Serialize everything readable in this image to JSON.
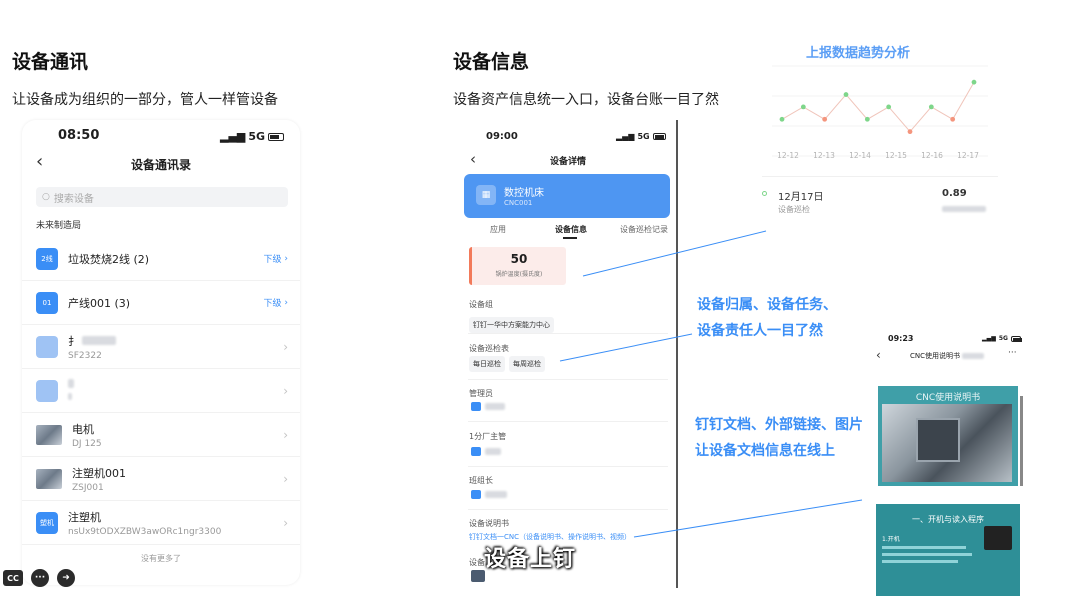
{
  "left_section": {
    "title": "设备通讯",
    "subtitle": "让设备成为组织的一部分，管人一样管设备"
  },
  "mid_section": {
    "title": "设备信息",
    "subtitle": "设备资产信息统一入口，设备台账一目了然"
  },
  "phone_left": {
    "time": "08:50",
    "network": "5G",
    "nav_title": "设备通讯录",
    "search_placeholder": "搜索设备",
    "org_name": "未来制造局",
    "rows": [
      {
        "icon_text": "2线",
        "name": "垃圾焚烧2线 (2)",
        "link": "下级"
      },
      {
        "icon_text": "01",
        "name": "产线001 (3)",
        "link": "下级"
      },
      {
        "name": "扌",
        "code": "SF2322"
      },
      {
        "name": "",
        "code": ""
      },
      {
        "name": "电机",
        "code": "DJ 125"
      },
      {
        "name": "注塑机001",
        "code": "ZSJ001"
      },
      {
        "icon_text": "塑机",
        "name": "注塑机",
        "code": "nsUx9tODXZBW3awORc1ngr3300"
      }
    ],
    "no_more": "没有更多了"
  },
  "phone_mid": {
    "time": "09:00",
    "network": "5G",
    "nav_title": "设备详情",
    "device_name": "数控机床",
    "device_code": "CNC001",
    "tabs": [
      "应用",
      "设备信息",
      "设备巡检记录"
    ],
    "metric_value": "50",
    "metric_label": "锅炉温度(摄氏度)",
    "group_label": "设备组",
    "group_value": "钉钉一华中方案能力中心",
    "inspection_label": "设备巡检表",
    "inspection_chips": [
      "每日巡检",
      "每周巡检"
    ],
    "manager_label": "管理员",
    "factory_label": "1分厂主管",
    "team_label": "班组长",
    "manual_label": "设备说明书",
    "manual_value": "钉钉文档一CNC（设备说明书、操作说明书、视频）",
    "more_label": "设备"
  },
  "trend": {
    "title": "上报数据趋势分析",
    "accent": "#3a8ef6"
  },
  "chart_data": {
    "type": "line",
    "title": "上报数据趋势分析",
    "x": [
      "12-12",
      "12-13",
      "12-14",
      "12-15",
      "12-16",
      "12-17"
    ],
    "series": [
      {
        "values": [
          0.86,
          0.87,
          0.86,
          0.88,
          0.86,
          0.87,
          0.85,
          0.87,
          0.86,
          0.89
        ],
        "colors": [
          "#7ed68a",
          "#7ed68a",
          "#f4957d",
          "#7ed68a",
          "#7ed68a",
          "#7ed68a",
          "#f4957d",
          "#7ed68a",
          "#f4957d",
          "#7ed68a"
        ]
      }
    ],
    "grid": true
  },
  "date_panel": {
    "date": "12月17日",
    "label": "设备巡检",
    "value": "0.89"
  },
  "annotations": {
    "ann1_line1": "设备归属、设备任务、",
    "ann1_line2": "设备责任人一目了然",
    "ann2_line1": "钉钉文档、外部链接、图片",
    "ann2_line2": "让设备文档信息在线上"
  },
  "phone_right": {
    "time": "09:23",
    "network": "5G",
    "nav_title": "CNC使用说明书",
    "doc_title": "CNC使用说明书",
    "section_heading": "一、开机与读入程序",
    "step": "1.开机"
  },
  "caption": "设备上钉",
  "bottom_bar": {
    "cc": "CC"
  }
}
